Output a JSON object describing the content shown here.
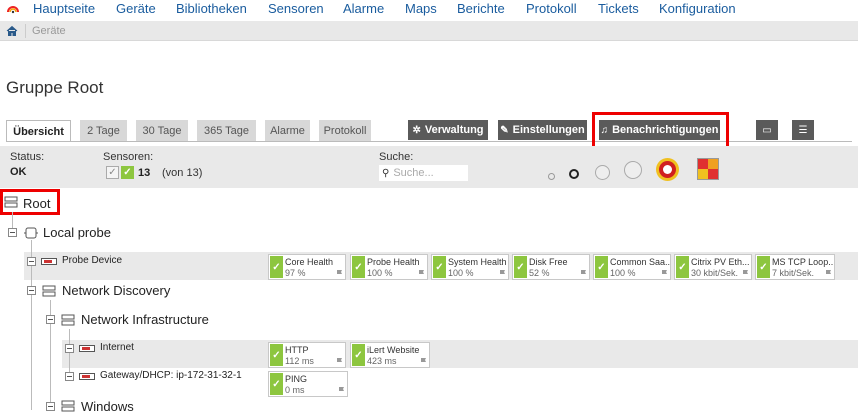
{
  "nav": {
    "items": [
      "Hauptseite",
      "Geräte",
      "Bibliotheken",
      "Sensoren",
      "Alarme",
      "Maps",
      "Berichte",
      "Protokoll",
      "Tickets",
      "Konfiguration"
    ]
  },
  "breadcrumb": {
    "current": "Geräte"
  },
  "page": {
    "title": "Gruppe Root"
  },
  "tabs": [
    "Übersicht",
    "2 Tage",
    "30 Tage",
    "365 Tage",
    "Alarme",
    "Protokoll"
  ],
  "actions": {
    "verwaltung": "Verwaltung",
    "einstellungen": "Einstellungen",
    "benachrichtigungen": "Benachrichtigungen"
  },
  "status": {
    "status_label": "Status:",
    "status_value": "OK",
    "sensors_label": "Sensoren:",
    "sensors_count": "13",
    "sensors_total": "(von 13)",
    "search_label": "Suche:",
    "search_placeholder": "Suche..."
  },
  "tree": {
    "root": "Root",
    "local_probe": "Local probe",
    "probe_device": "Probe Device",
    "network_discovery": "Network Discovery",
    "network_infrastructure": "Network Infrastructure",
    "internet": "Internet",
    "gateway": "Gateway/DHCP: ip-172-31-32-1",
    "windows": "Windows"
  },
  "sensors": {
    "probe_device": [
      {
        "name": "Core Health",
        "value": "97 %"
      },
      {
        "name": "Probe Health",
        "value": "100 %"
      },
      {
        "name": "System Health",
        "value": "100 %"
      },
      {
        "name": "Disk Free",
        "value": "52 %"
      },
      {
        "name": "Common Saa...",
        "value": "100 %"
      },
      {
        "name": "Citrix PV Eth...",
        "value": "30 kbit/Sek."
      },
      {
        "name": "MS TCP Loop...",
        "value": "7 kbit/Sek."
      }
    ],
    "internet": [
      {
        "name": "HTTP",
        "value": "112 ms"
      },
      {
        "name": "iLert Website",
        "value": "423 ms"
      }
    ],
    "gateway": [
      {
        "name": "PING",
        "value": "0 ms"
      }
    ]
  },
  "colors": {
    "ok_green": "#8dc63f",
    "highlight_red": "#e00000",
    "nav_blue": "#1a5c9e",
    "button_dark": "#5a5a5a"
  },
  "icons": [
    "prtg-logo-icon",
    "home-icon",
    "gear-icon",
    "wrench-icon",
    "bell-icon",
    "comment-icon",
    "list-icon",
    "search-icon",
    "check-icon",
    "flag-icon",
    "group-icon",
    "probe-icon",
    "device-icon"
  ]
}
